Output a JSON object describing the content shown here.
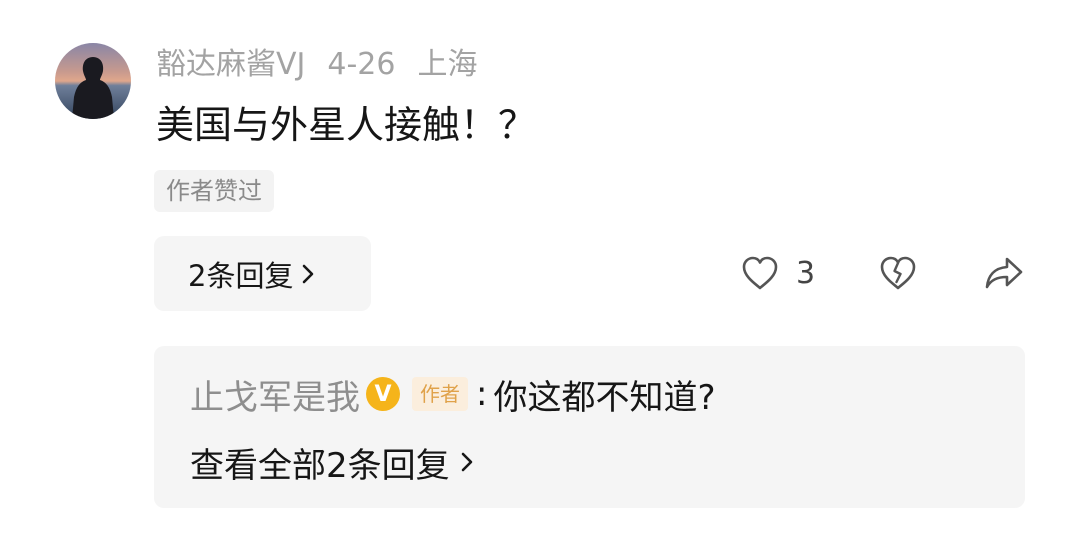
{
  "comment": {
    "username": "豁达麻酱VJ",
    "date": "4-26",
    "location": "上海",
    "text": "美国与外星人接触！？",
    "liked_by_author_label": "作者赞过",
    "replies_button_label": "2条回复",
    "like_count": "3",
    "icons": {
      "avatar": "person-silhouette-sunset-avatar",
      "like": "heart-icon",
      "dislike": "broken-heart-icon",
      "share": "share-arrow-icon",
      "chevron": "chevron-right-icon"
    }
  },
  "reply_preview": {
    "username": "止戈军是我",
    "verified_badge": "V",
    "author_tag": "作者",
    "separator": ":",
    "text": "你这都不知道?",
    "view_all_label": "查看全部2条回复"
  },
  "colors": {
    "meta_gray": "#a3a3a3",
    "panel_bg": "#f5f5f5",
    "badge_gold": "#f5b41a",
    "author_tag_bg": "#fbeedd",
    "author_tag_text": "#e0a24a"
  }
}
